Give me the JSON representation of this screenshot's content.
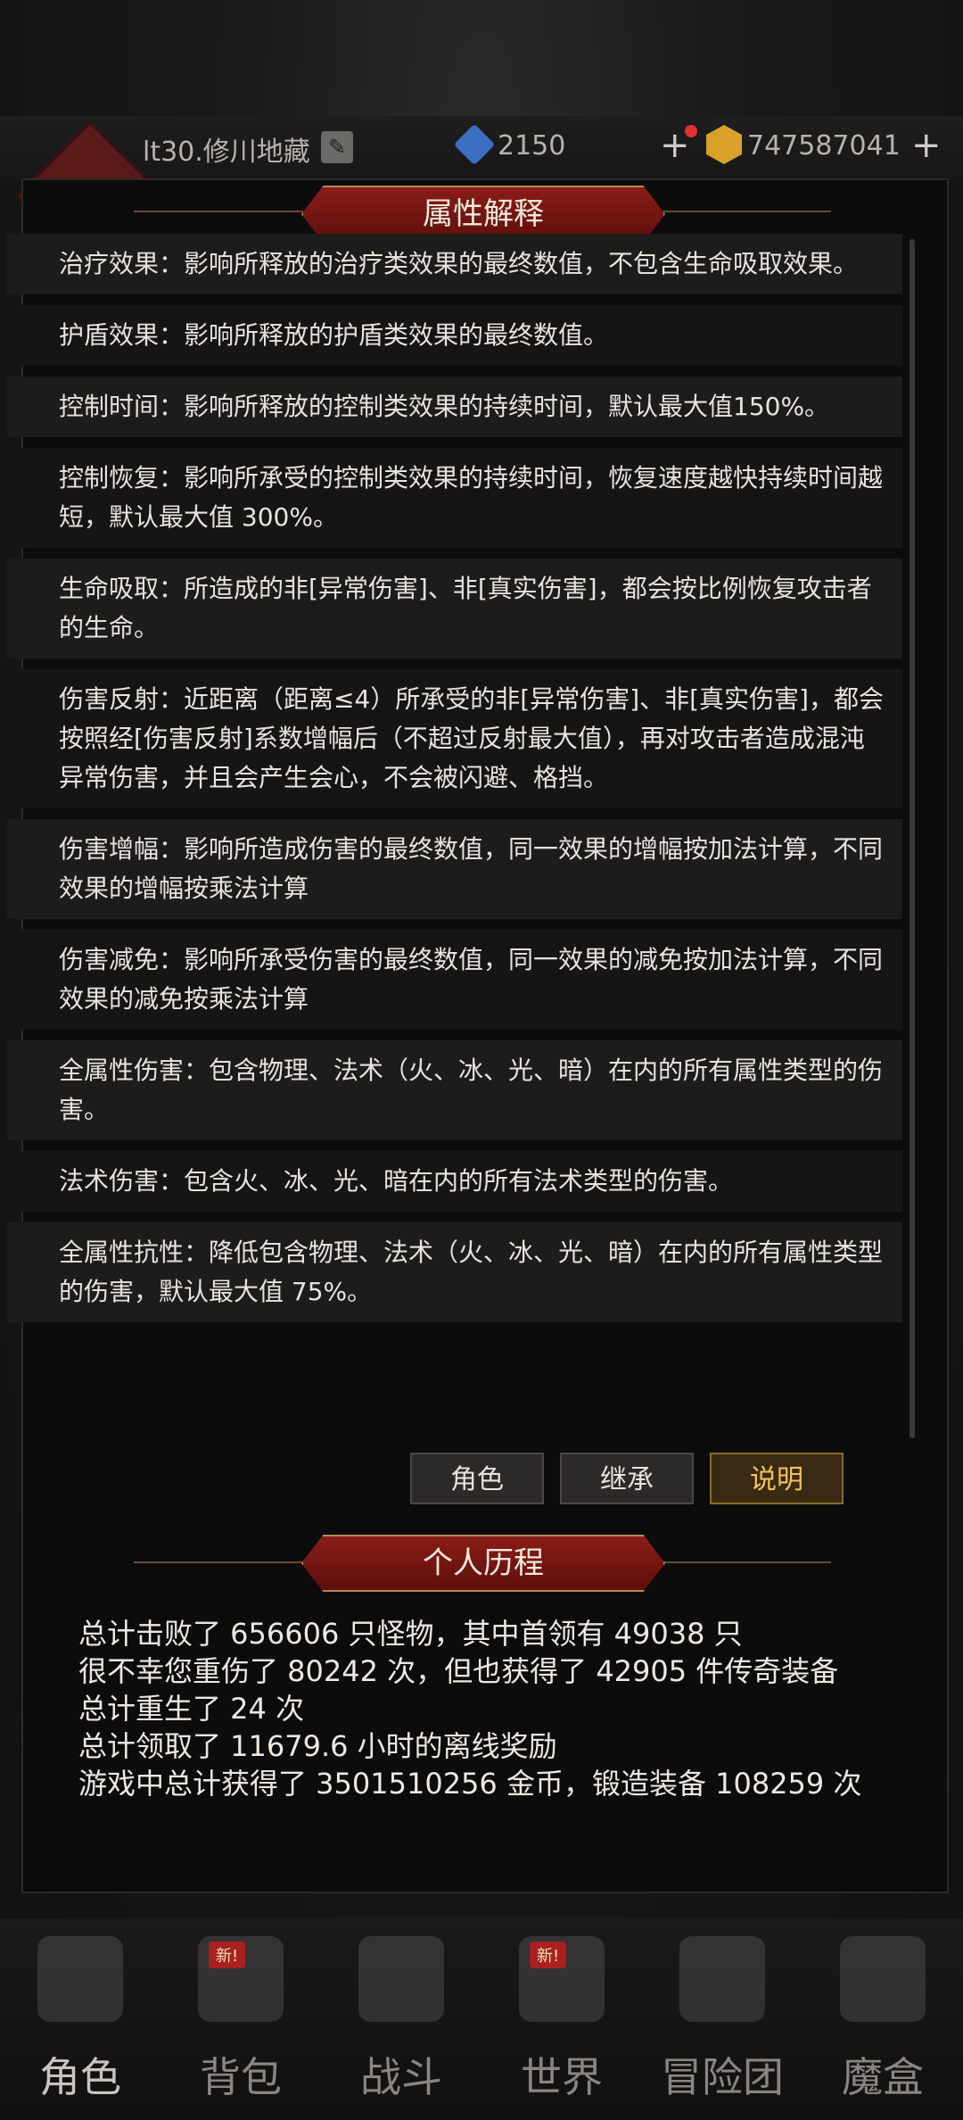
{
  "header": {
    "player_name": "lt30.修川地藏",
    "gems": "2150",
    "gold": "747587041"
  },
  "dialog": {
    "title": "属性解释",
    "attributes": [
      "治疗效果：影响所释放的治疗类效果的最终数值，不包含生命吸取效果。",
      "护盾效果：影响所释放的护盾类效果的最终数值。",
      "控制时间：影响所释放的控制类效果的持续时间，默认最大值150%。",
      "控制恢复：影响所承受的控制类效果的持续时间，恢复速度越快持续时间越短，默认最大值 300%。",
      "生命吸取：所造成的非[异常伤害]、非[真实伤害]，都会按比例恢复攻击者的生命。",
      "伤害反射：近距离（距离≤4）所承受的非[异常伤害]、非[真实伤害]，都会按照经[伤害反射]系数增幅后（不超过反射最大值），再对攻击者造成混沌异常伤害，并且会产生会心，不会被闪避、格挡。",
      "伤害增幅：影响所造成伤害的最终数值，同一效果的增幅按加法计算，不同效果的增幅按乘法计算",
      "伤害减免：影响所承受伤害的最终数值，同一效果的减免按加法计算，不同效果的减免按乘法计算",
      "全属性伤害：包含物理、法术（火、冰、光、暗）在内的所有属性类型的伤害。",
      "法术伤害：包含火、冰、光、暗在内的所有法术类型的伤害。",
      "全属性抗性：降低包含物理、法术（火、冰、光、暗）在内的所有属性类型的伤害，默认最大值 75%。"
    ],
    "tabs": [
      "角色",
      "继承",
      "说明"
    ],
    "active_tab": "说明",
    "history_title": "个人历程",
    "history": [
      "总计击败了 656606 只怪物，其中首领有 49038 只",
      "很不幸您重伤了 80242 次，但也获得了 42905 件传奇装备",
      "总计重生了 24 次",
      "总计领取了 11679.6 小时的离线奖励",
      "游戏中总计获得了 3501510256 金币，锻造装备 108259 次"
    ]
  },
  "bottom_nav": {
    "items": [
      {
        "label": "角色",
        "icon": "helmet-icon",
        "badge": ""
      },
      {
        "label": "背包",
        "icon": "backpack-icon",
        "badge": "新!"
      },
      {
        "label": "战斗",
        "icon": "sword-shield-icon",
        "badge": ""
      },
      {
        "label": "世界",
        "icon": "scroll-map-icon",
        "badge": "新!"
      },
      {
        "label": "冒险团",
        "icon": "castle-icon",
        "badge": ""
      },
      {
        "label": "魔盒",
        "icon": "cube-icon",
        "badge": ""
      }
    ],
    "active": "角色"
  },
  "colors": {
    "banner": "#8a1c18",
    "active_tab_text": "#f3c45a",
    "gem": "#3a6fc2",
    "gold": "#d7a12a"
  }
}
